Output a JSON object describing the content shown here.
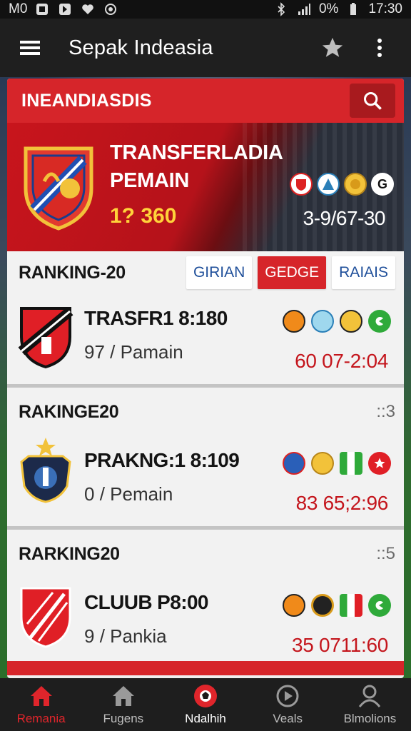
{
  "status_bar": {
    "left_text": "M0",
    "battery": "0%",
    "time": "17:30"
  },
  "app_bar": {
    "title": "Sepak Indeasia"
  },
  "card": {
    "header_title": "INEANDIASDIS",
    "hero": {
      "line1": "TRANSFERLADIA",
      "line2": "PEMAIN",
      "number": "1? 360",
      "score": "3-9/67-30",
      "badges": [
        "club-badge-red",
        "club-badge-blue",
        "club-badge-gold",
        "G"
      ]
    }
  },
  "sections": [
    {
      "title": "RANKING-20",
      "tabs": [
        "GIRIAN",
        "GEDGE",
        "RAIAIS"
      ],
      "active_tab": 1,
      "row": {
        "name": "TRASFR1 8:180",
        "sub_num": "97",
        "sub_label": "Pamain",
        "score": "60 07-2:04",
        "badges": [
          "club-badge-orange",
          "club-badge-cyan",
          "club-badge-yellow",
          "club-badge-green"
        ]
      }
    },
    {
      "title": "RAKINGE20",
      "count": "::3",
      "row": {
        "name": "PRAKNG:1 8:109",
        "sub_num": "0",
        "sub_label": "Pemain",
        "score": "83 65;2:96",
        "badges": [
          "club-badge-blue",
          "club-badge-gold",
          "club-badge-green-stripe",
          "club-badge-red-star"
        ]
      }
    },
    {
      "title": "RARKING20",
      "count": "::5",
      "row": {
        "name": "CLUUB P8:00",
        "sub_num": "9",
        "sub_label": "Pankia",
        "score": "35 0711:60",
        "badges": [
          "club-badge-orange",
          "club-badge-dark",
          "club-badge-green-stripe",
          "club-badge-green"
        ]
      }
    }
  ],
  "bottom_nav": [
    {
      "label": "Remania",
      "icon": "home-icon"
    },
    {
      "label": "Fugens",
      "icon": "home-icon"
    },
    {
      "label": "Ndalhih",
      "icon": "ball-icon"
    },
    {
      "label": "Veals",
      "icon": "play-icon"
    },
    {
      "label": "Blmolions",
      "icon": "profile-icon"
    }
  ],
  "colors": {
    "accent": "#d6252a",
    "score": "#c4151c",
    "hero_number": "#ffd23a"
  }
}
